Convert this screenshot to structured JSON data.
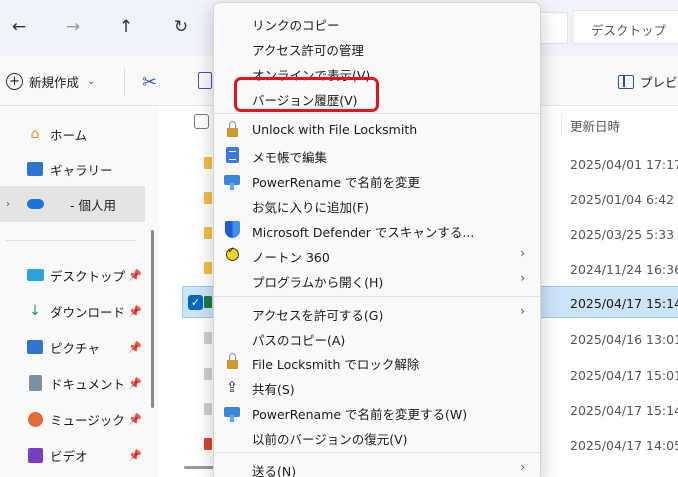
{
  "explorer": {
    "nav": {
      "back": "←",
      "forward": "→",
      "up": "↑",
      "refresh": "↻"
    },
    "search_placeholder": "デスクトップ",
    "toolbar": {
      "new_label": "新規作成",
      "preview_label": "プレビュー"
    },
    "sidebar": {
      "items": [
        {
          "label": "ホーム",
          "icon": "home-icon"
        },
        {
          "label": "ギャラリー",
          "icon": "gallery-icon"
        },
        {
          "label": "- 個人用",
          "icon": "onedrive-icon"
        },
        {
          "label": "デスクトップ",
          "icon": "desktop-icon"
        },
        {
          "label": "ダウンロード",
          "icon": "download-icon"
        },
        {
          "label": "ピクチャ",
          "icon": "pictures-icon"
        },
        {
          "label": "ドキュメント",
          "icon": "documents-icon"
        },
        {
          "label": "ミュージック",
          "icon": "music-icon"
        },
        {
          "label": "ビデオ",
          "icon": "video-icon"
        }
      ]
    },
    "column_header": "更新日時",
    "rows": [
      {
        "date": "2025/04/01 17:17",
        "type": "folder"
      },
      {
        "date": "2025/01/04 6:42",
        "type": "folder"
      },
      {
        "date": "2025/03/25 5:33",
        "type": "folder"
      },
      {
        "date": "2024/11/24 16:36",
        "type": "folder"
      },
      {
        "date": "2025/04/17 15:14",
        "type": "excel",
        "selected": true
      },
      {
        "date": "2025/04/16 13:01",
        "type": "file"
      },
      {
        "date": "2025/04/17 15:01",
        "type": "file"
      },
      {
        "date": "2025/04/17 15:14",
        "type": "file"
      },
      {
        "date": "2025/04/17 14:05",
        "type": "file"
      }
    ]
  },
  "context_menu": {
    "items": [
      {
        "label": "リンクのコピー",
        "icon": "",
        "arrow": false
      },
      {
        "label": "アクセス許可の管理",
        "icon": "",
        "arrow": false
      },
      {
        "label": "オンラインで表示(V)",
        "icon": "",
        "arrow": false
      },
      {
        "label": "バージョン履歴(V)",
        "icon": "",
        "arrow": false,
        "highlighted": true
      },
      {
        "label": "Unlock with File Locksmith",
        "icon": "lock-icon",
        "arrow": false
      },
      {
        "label": "メモ帳で編集",
        "icon": "notepad-icon",
        "arrow": false
      },
      {
        "label": "PowerRename で名前を変更",
        "icon": "powerrename-icon",
        "arrow": false
      },
      {
        "label": "お気に入りに追加(F)",
        "icon": "",
        "arrow": false
      },
      {
        "label": "Microsoft Defender でスキャンする...",
        "icon": "defender-shield-icon",
        "arrow": false
      },
      {
        "label": "ノートン 360",
        "icon": "norton-icon",
        "arrow": true
      },
      {
        "label": "プログラムから開く(H)",
        "icon": "",
        "arrow": true
      },
      {
        "label": "アクセスを許可する(G)",
        "icon": "",
        "arrow": true
      },
      {
        "label": "パスのコピー(A)",
        "icon": "",
        "arrow": false
      },
      {
        "label": "File Locksmith でロック解除",
        "icon": "lock-icon",
        "arrow": false
      },
      {
        "label": "共有(S)",
        "icon": "share-icon",
        "arrow": false
      },
      {
        "label": "PowerRename で名前を変更する(W)",
        "icon": "powerrename-icon",
        "arrow": false
      },
      {
        "label": "以前のバージョンの復元(V)",
        "icon": "",
        "arrow": false
      },
      {
        "label": "送る(N)",
        "icon": "",
        "arrow": true
      }
    ],
    "arrow_glyph": "›",
    "highlight_color": "#e3141c"
  }
}
